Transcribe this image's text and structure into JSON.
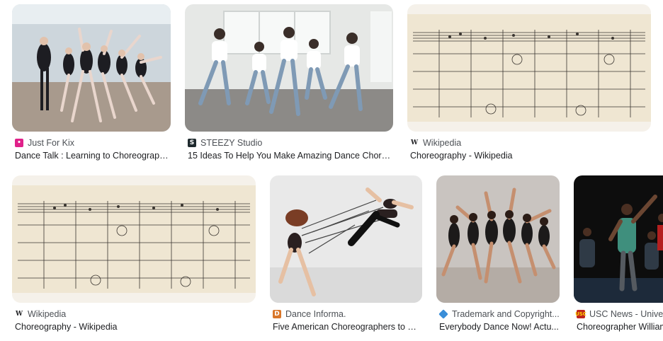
{
  "results": [
    {
      "source": "Just For Kix",
      "title": "Dance Talk : Learning to Choreograph...",
      "favicon": "kix-favicon-icon",
      "favicon_color": "#e0218a"
    },
    {
      "source": "STEEZY Studio",
      "title": "15 Ideas To Help You Make Amazing Dance Chore...",
      "favicon": "steezy-favicon-icon",
      "favicon_color": "#1f2a2e"
    },
    {
      "source": "Wikipedia",
      "title": "Choreography - Wikipedia",
      "favicon": "wikipedia-favicon-icon",
      "favicon_color": "#ffffff"
    },
    {
      "source": "Wikipedia",
      "title": "Choreography - Wikipedia",
      "favicon": "wikipedia-favicon-icon",
      "favicon_color": "#ffffff"
    },
    {
      "source": "Dance Informa.",
      "title": "Five American Choreographers to W...",
      "favicon": "dance-informa-favicon-icon",
      "favicon_color": "#d9772a"
    },
    {
      "source": "Trademark and Copyright...",
      "title": "Everybody Dance Now! Actu...",
      "favicon": "trademark-favicon-icon",
      "favicon_color": "#3a8ed8"
    },
    {
      "source": "USC News - Univers",
      "title": "Choreographer William",
      "favicon": "usc-favicon-icon",
      "favicon_color": "#c0261b"
    }
  ]
}
